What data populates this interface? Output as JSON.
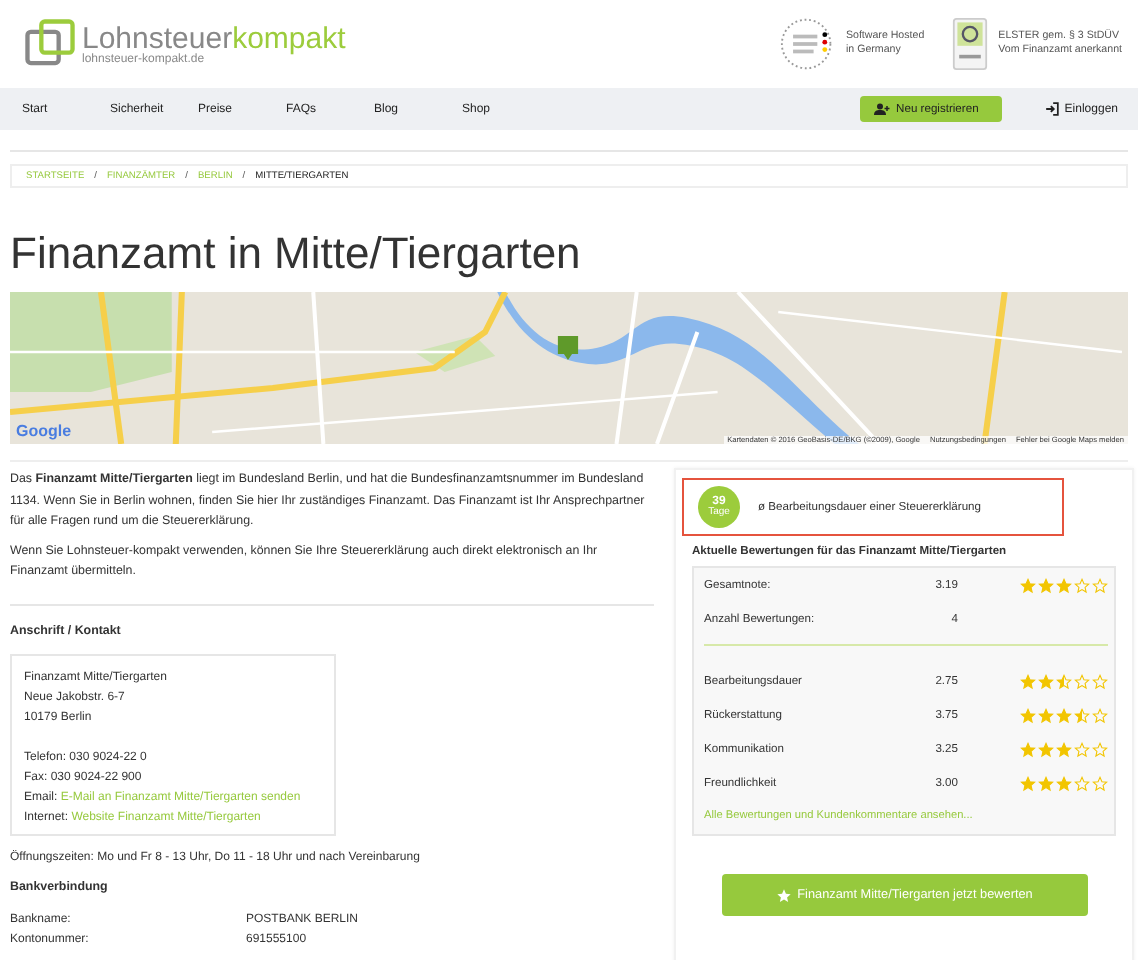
{
  "header": {
    "logo": {
      "name_regular": "Lohnsteuer",
      "name_accent": "kompakt",
      "domain": "lohnsteuer-kompakt.de"
    },
    "badges": [
      {
        "kind": "hosted",
        "lines": [
          "Software Hosted",
          "in Germany"
        ]
      },
      {
        "kind": "elster",
        "lines": [
          "ELSTER gem. § 3 StDÜV",
          "Vom Finanzamt anerkannt"
        ]
      }
    ]
  },
  "nav": {
    "items": [
      {
        "label": "Start"
      },
      {
        "label": "Sicherheit"
      },
      {
        "label": "Preise"
      },
      {
        "label": "FAQs"
      },
      {
        "label": "Blog"
      },
      {
        "label": "Shop"
      }
    ],
    "register_button": "Neu registrieren",
    "login_link": "Einloggen"
  },
  "breadcrumb_separator": "/",
  "breadcrumb": [
    {
      "label": "STARTSEITE",
      "current": false
    },
    {
      "label": "FINANZÄMTER",
      "current": false
    },
    {
      "label": "BERLIN",
      "current": false
    },
    {
      "label": "MITTE/TIERGARTEN",
      "current": true
    }
  ],
  "page_title": "Finanzamt in Mitte/Tiergarten",
  "map": {
    "logo": "Google",
    "attribution": "Kartendaten © 2016 GeoBasis-DE/BKG (©2009), Google",
    "links": [
      "Nutzungsbedingungen",
      "Fehler bei Google Maps melden"
    ]
  },
  "intro_paragraphs": [
    "Das **Finanzamt Mitte/Tiergarten** liegt im Bundesland Berlin, und hat die Bundesfinanzamtsnummer im Bundesland 1134. Wenn Sie in Berlin wohnen, finden Sie hier Ihr zuständiges Finanzamt. Das Finanzamt ist Ihr Ansprechpartner für alle Fragen rund um die Steuererklärung.",
    "Wenn Sie Lohnsteuer-kompakt verwenden, können Sie Ihre Steuererklärung auch direkt elektronisch an Ihr Finanzamt übermitteln."
  ],
  "contact": {
    "heading": "Anschrift / Kontakt",
    "address_lines": [
      "Finanzamt Mitte/Tiergarten",
      "Neue Jakobstr. 6-7",
      "10179 Berlin"
    ],
    "phone": "Telefon: 030 9024-22 0",
    "fax": "Fax: 030 9024-22 900",
    "links": [
      {
        "label": "Email:",
        "link": "E-Mail an Finanzamt Mitte/Tiergarten senden"
      },
      {
        "label": "Internet:",
        "link": "Website Finanzamt Mitte/Tiergarten"
      }
    ]
  },
  "opening_hours": "Öffnungszeiten: Mo und Fr 8 - 13 Uhr, Do 11 - 18 Uhr und nach Vereinbarung",
  "bank": {
    "heading": "Bankverbindung",
    "rows": [
      {
        "label": "Bankname:",
        "value": "POSTBANK BERLIN"
      },
      {
        "label": "Kontonummer:",
        "value": "691555100"
      }
    ]
  },
  "processing": {
    "days": "39",
    "unit": "Tage",
    "label": "ø Bearbeitungsdauer einer Steuererklärung"
  },
  "ratings": {
    "heading": "Aktuelle Bewertungen für das Finanzamt Mitte/Tiergarten",
    "summary": [
      {
        "label": "Gesamtnote:",
        "value": "3.19",
        "stars": 3
      },
      {
        "label": "Anzahl Bewertungen:",
        "value": "4"
      }
    ],
    "categories": [
      {
        "label": "Bearbeitungsdauer",
        "value": "2.75",
        "stars": 2.5
      },
      {
        "label": "Rückerstattung",
        "value": "3.75",
        "stars": 3.5
      },
      {
        "label": "Kommunikation",
        "value": "3.25",
        "stars": 3
      },
      {
        "label": "Freundlichkeit",
        "value": "3.00",
        "stars": 3
      }
    ],
    "link": "Alle Bewertungen und Kundenkommentare ansehen..."
  },
  "rate_button": "Finanzamt Mitte/Tiergarten jetzt bewerten"
}
